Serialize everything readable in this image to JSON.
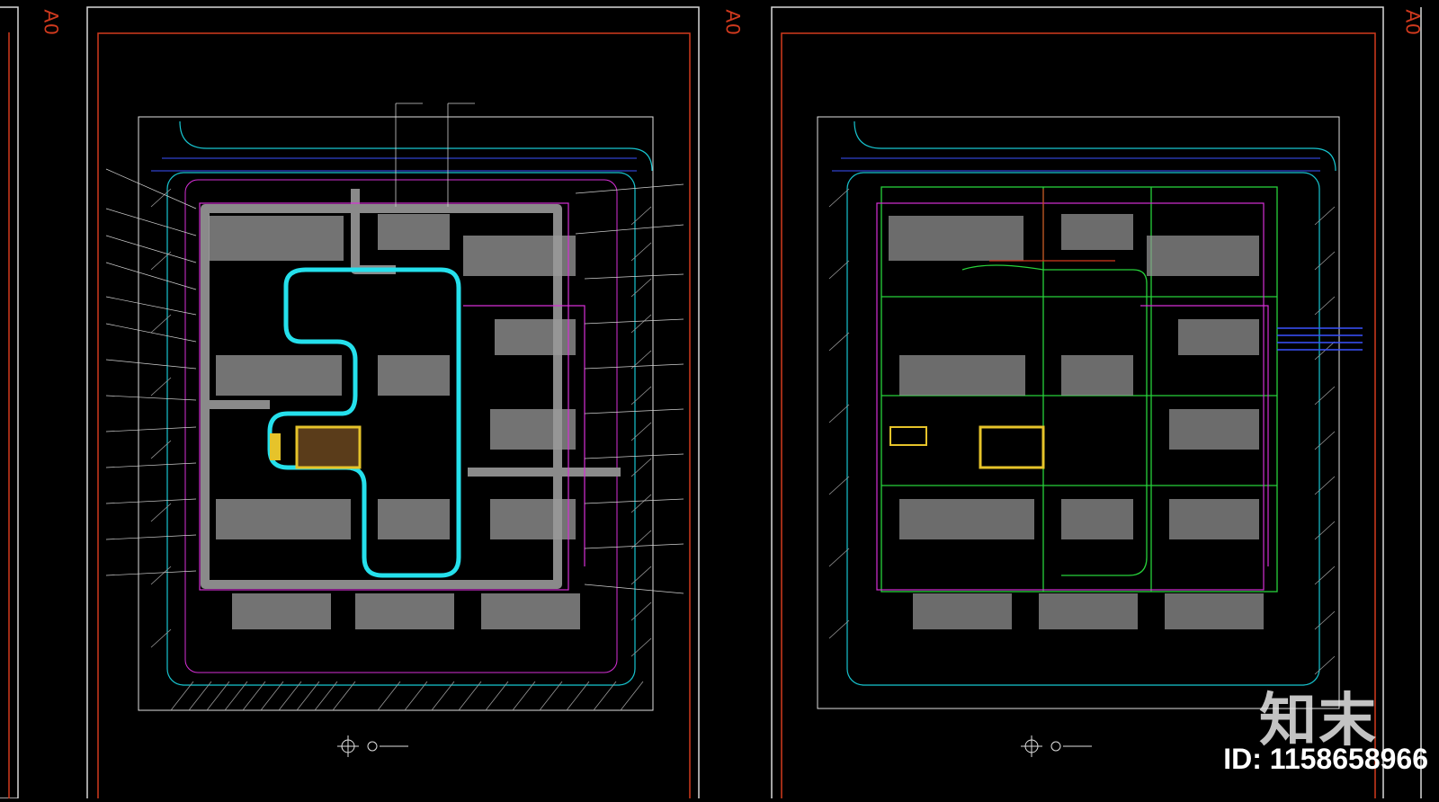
{
  "sheets": [
    {
      "label": "A0"
    },
    {
      "label": "A0"
    },
    {
      "label": "A0"
    }
  ],
  "watermark": {
    "brand": "知末",
    "id_text": "ID: 1158658966"
  },
  "colors": {
    "background": "#000000",
    "sheet_border": "#d9d9d9",
    "frame_red": "#d23a1e",
    "road": "#8a8a8a",
    "loop_path": "#25e0ec",
    "boundary_cyan": "#17c5d0",
    "magenta": "#d62fd6",
    "green_line": "#27d13a",
    "building_gray": "#9a9a9a",
    "plaza_yellow": "#e6c32a",
    "blue_line": "#3b52ff"
  }
}
